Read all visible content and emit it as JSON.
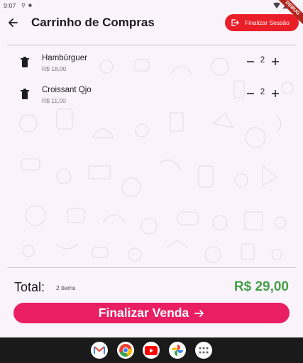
{
  "status_bar": {
    "time": "9:07"
  },
  "debug_banner": "DEBUG",
  "app_bar": {
    "title": "Carrinho de Compras",
    "end_session_label": "Finalizar Sessão"
  },
  "cart": {
    "items": [
      {
        "name": "Hambúrguer",
        "price": "R$ 18,00",
        "quantity": "2"
      },
      {
        "name": "Croissant Qjo",
        "price": "R$ 11,00",
        "quantity": "2"
      }
    ]
  },
  "summary": {
    "total_label": "Total:",
    "items_count": "2 items",
    "total_value": "R$ 29,00"
  },
  "checkout": {
    "label": "Finalizar Venda"
  },
  "dock": {
    "apps": [
      "gmail-icon",
      "chrome-icon",
      "youtube-icon",
      "photos-icon",
      "app-drawer-icon"
    ]
  },
  "colors": {
    "background": "#fbf3fb",
    "end_session_button": "#ea1e28",
    "checkout_button": "#e91e63",
    "total_value": "#43a047"
  }
}
